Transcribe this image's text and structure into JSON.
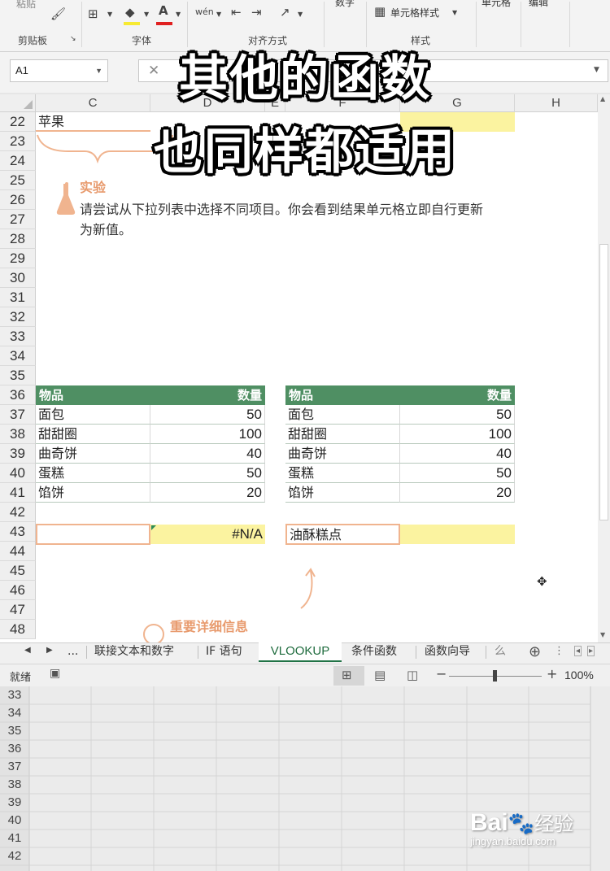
{
  "overlay": {
    "line1": "其他的函数",
    "line2": "也同样都适用"
  },
  "ribbon": {
    "paste": "粘贴",
    "groups": {
      "clipboard": "剪贴板",
      "font": "字体",
      "alignment": "对齐方式",
      "styles": "样式"
    },
    "cell_style": "单元格样式",
    "number": "数字",
    "cells": "单元格",
    "editing": "编辑"
  },
  "namebox": {
    "value": "A1"
  },
  "columns": [
    "C",
    "D",
    "E",
    "F",
    "G",
    "H"
  ],
  "rows": [
    "22",
    "23",
    "24",
    "25",
    "26",
    "27",
    "28",
    "29",
    "30",
    "31",
    "32",
    "33",
    "34",
    "35",
    "36",
    "37",
    "38",
    "39",
    "40",
    "41",
    "42",
    "43",
    "44",
    "45",
    "46",
    "47",
    "48"
  ],
  "cells": {
    "c22": "苹果"
  },
  "experiment": {
    "title": "实验",
    "text": "请尝试从下拉列表中选择不同项目。你会看到结果单元格立即自行更新为新值。"
  },
  "table1": {
    "headers": [
      "物品",
      "数量"
    ],
    "rows": [
      {
        "item": "面包",
        "qty": "50"
      },
      {
        "item": "甜甜圈",
        "qty": "100"
      },
      {
        "item": "曲奇饼",
        "qty": "40"
      },
      {
        "item": "蛋糕",
        "qty": "50"
      },
      {
        "item": "馅饼",
        "qty": "20"
      }
    ],
    "result": "#N/A"
  },
  "table2": {
    "headers": [
      "物品",
      "数量"
    ],
    "rows": [
      {
        "item": "面包",
        "qty": "50"
      },
      {
        "item": "甜甜圈",
        "qty": "100"
      },
      {
        "item": "曲奇饼",
        "qty": "40"
      },
      {
        "item": "蛋糕",
        "qty": "50"
      },
      {
        "item": "馅饼",
        "qty": "20"
      }
    ],
    "lookup": "油酥糕点"
  },
  "important": "重要详细信息",
  "tabs": {
    "ellipsis": "...",
    "items": [
      "联接文本和数字",
      "IF 语句",
      "VLOOKUP",
      "条件函数",
      "函数向导",
      "么"
    ],
    "active": "VLOOKUP"
  },
  "status": {
    "ready": "就绪",
    "zoom": "100%"
  },
  "lower_rows": [
    "33",
    "34",
    "35",
    "36",
    "37",
    "38",
    "39",
    "40",
    "41",
    "42"
  ],
  "watermark": {
    "brand": "Bai",
    "suffix": "经验",
    "url": "jingyan.baidu.com"
  },
  "colors": {
    "table_header": "#4f8f63",
    "highlight": "#fbf3a0",
    "accent": "#e89b6e",
    "excel_green": "#217346"
  }
}
